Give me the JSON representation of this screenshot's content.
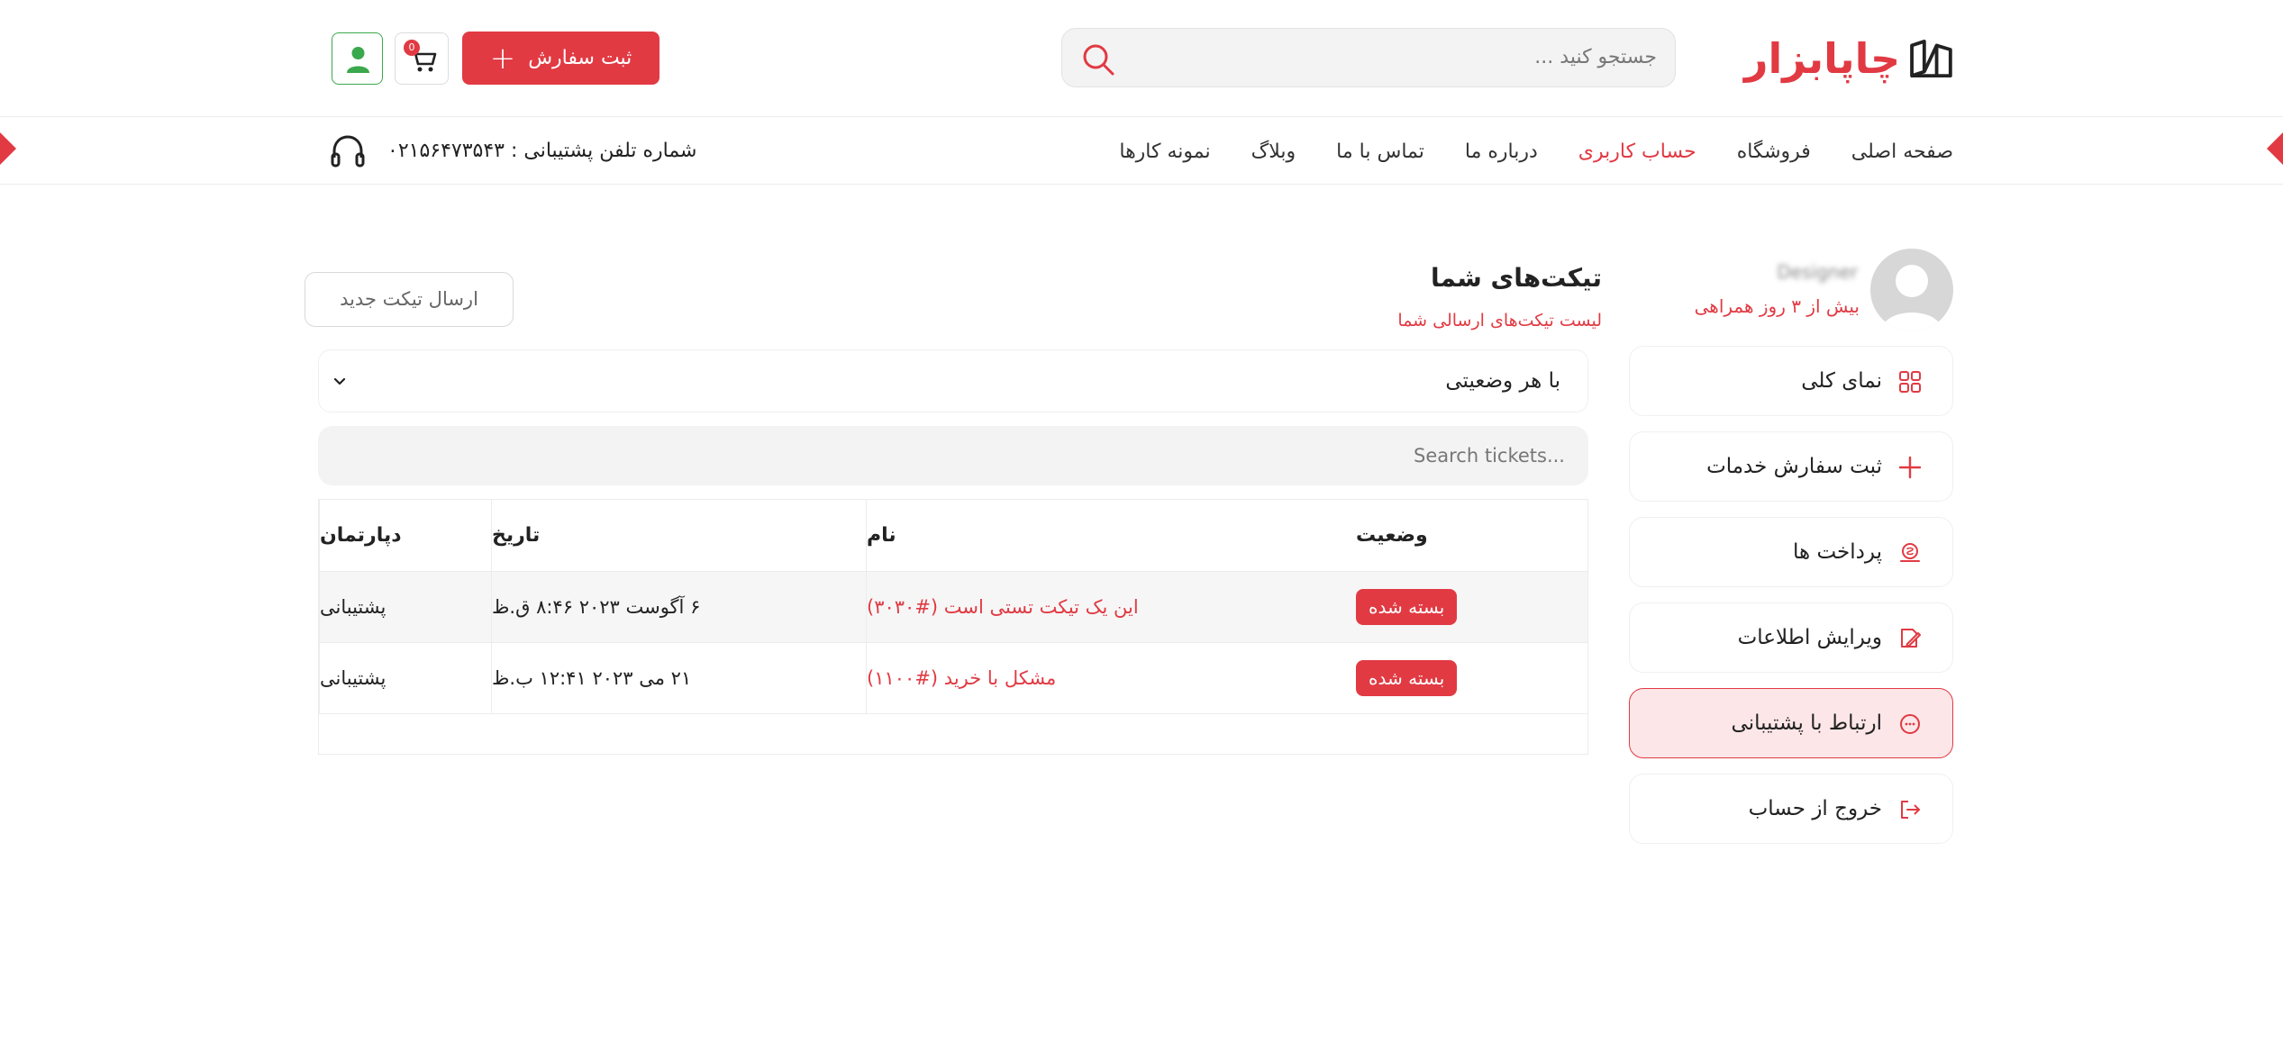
{
  "header": {
    "logo_text": "چاپابزار",
    "search_placeholder": "جستجو کنید ...",
    "order_button": "ثبت سفارش",
    "cart_count": "0"
  },
  "nav": {
    "items": [
      "صفحه اصلی",
      "فروشگاه",
      "حساب کاربری",
      "درباره ما",
      "تماس با ما",
      "وبلاگ",
      "نمونه کارها"
    ],
    "active_index": 2,
    "support_phone": "شماره تلفن پشتیبانی : ۰۲۱۵۶۴۷۳۵۴۳"
  },
  "sidebar": {
    "username": "Designer",
    "membership": "بیش از ۳ روز همراهی",
    "items": [
      {
        "label": "نمای کلی",
        "icon": "grid-icon"
      },
      {
        "label": "ثبت سفارش خدمات",
        "icon": "plus-icon"
      },
      {
        "label": "پرداخت ها",
        "icon": "money-icon"
      },
      {
        "label": "ویرایش اطلاعات",
        "icon": "edit-icon"
      },
      {
        "label": "ارتباط با پشتیبانی",
        "icon": "chat-icon"
      },
      {
        "label": "خروج از حساب",
        "icon": "logout-icon"
      }
    ],
    "active_index": 4
  },
  "main": {
    "title": "تیکت‌های شما",
    "subtitle": "لیست تیکت‌های ارسالی شما",
    "new_ticket_button": "ارسال تیکت جدید",
    "status_filter": "با هر وضعیتی",
    "search_placeholder": "Search tickets...",
    "table": {
      "headers": {
        "status": "وضعیت",
        "name": "نام",
        "date": "تاریخ",
        "department": "دپارتمان"
      },
      "rows": [
        {
          "status": "بسته شده",
          "name": "این یک تیکت تستی است (#۳۰۳۰)",
          "date": "۶ آگوست ۲۰۲۳ ۸:۴۶ ق.ظ",
          "department": "پشتیبانی"
        },
        {
          "status": "بسته شده",
          "name": "مشکل با خرید (#۱۱۰۰)",
          "date": "۲۱ می ۲۰۲۳ ۱۲:۴۱ ب.ظ",
          "department": "پشتیبانی"
        }
      ]
    }
  },
  "colors": {
    "accent": "#e13a43",
    "active_bg": "#fde6e8",
    "user_green": "#3aa84d"
  }
}
